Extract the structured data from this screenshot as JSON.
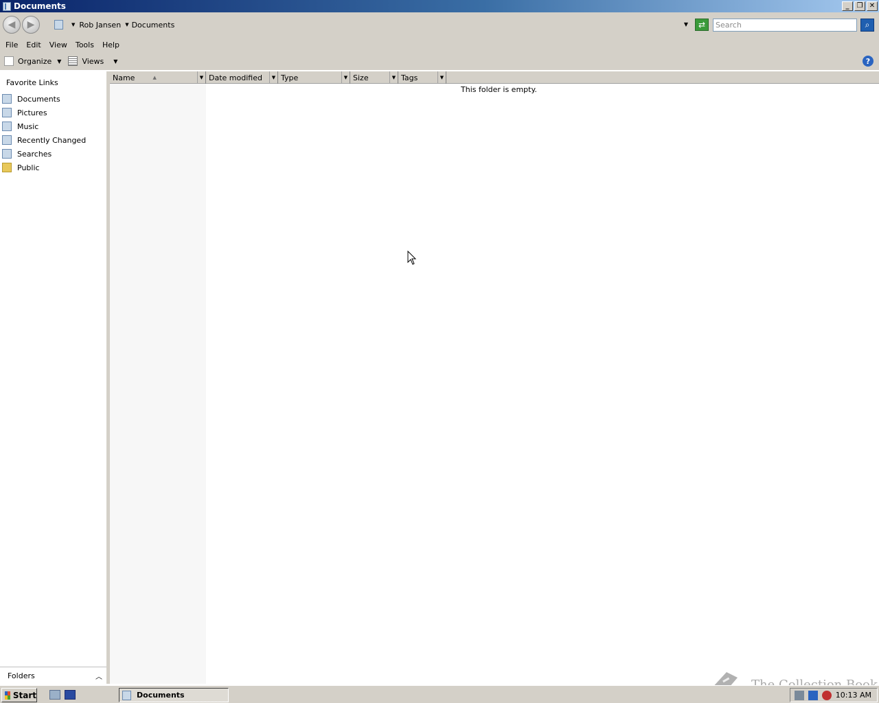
{
  "window": {
    "title": "Documents",
    "buttons": {
      "minimize": "_",
      "restore": "❐",
      "close": "✕"
    }
  },
  "address": {
    "breadcrumb": [
      "Rob Jansen",
      "Documents"
    ],
    "search_placeholder": "Search"
  },
  "menubar": [
    "File",
    "Edit",
    "View",
    "Tools",
    "Help"
  ],
  "commandbar": {
    "organize": "Organize",
    "views": "Views",
    "help": "?"
  },
  "navpane": {
    "heading": "Favorite Links",
    "items": [
      {
        "label": "Documents",
        "icon": "documents-icon"
      },
      {
        "label": "Pictures",
        "icon": "pictures-icon"
      },
      {
        "label": "Music",
        "icon": "music-icon"
      },
      {
        "label": "Recently Changed",
        "icon": "recently-changed-icon"
      },
      {
        "label": "Searches",
        "icon": "searches-icon"
      },
      {
        "label": "Public",
        "icon": "folder-icon"
      }
    ],
    "folders_label": "Folders"
  },
  "filelist": {
    "columns": [
      "Name",
      "Date modified",
      "Type",
      "Size",
      "Tags"
    ],
    "sorted_by": "Name",
    "empty_message": "This folder is empty."
  },
  "taskbar": {
    "start": "Start",
    "task_button": "Documents",
    "clock": "10:13 AM"
  },
  "watermark": "The Collection Book",
  "colors": {
    "title_gradient_start": "#0a246a",
    "title_gradient_end": "#a6caf0",
    "chrome": "#d4d0c8"
  }
}
